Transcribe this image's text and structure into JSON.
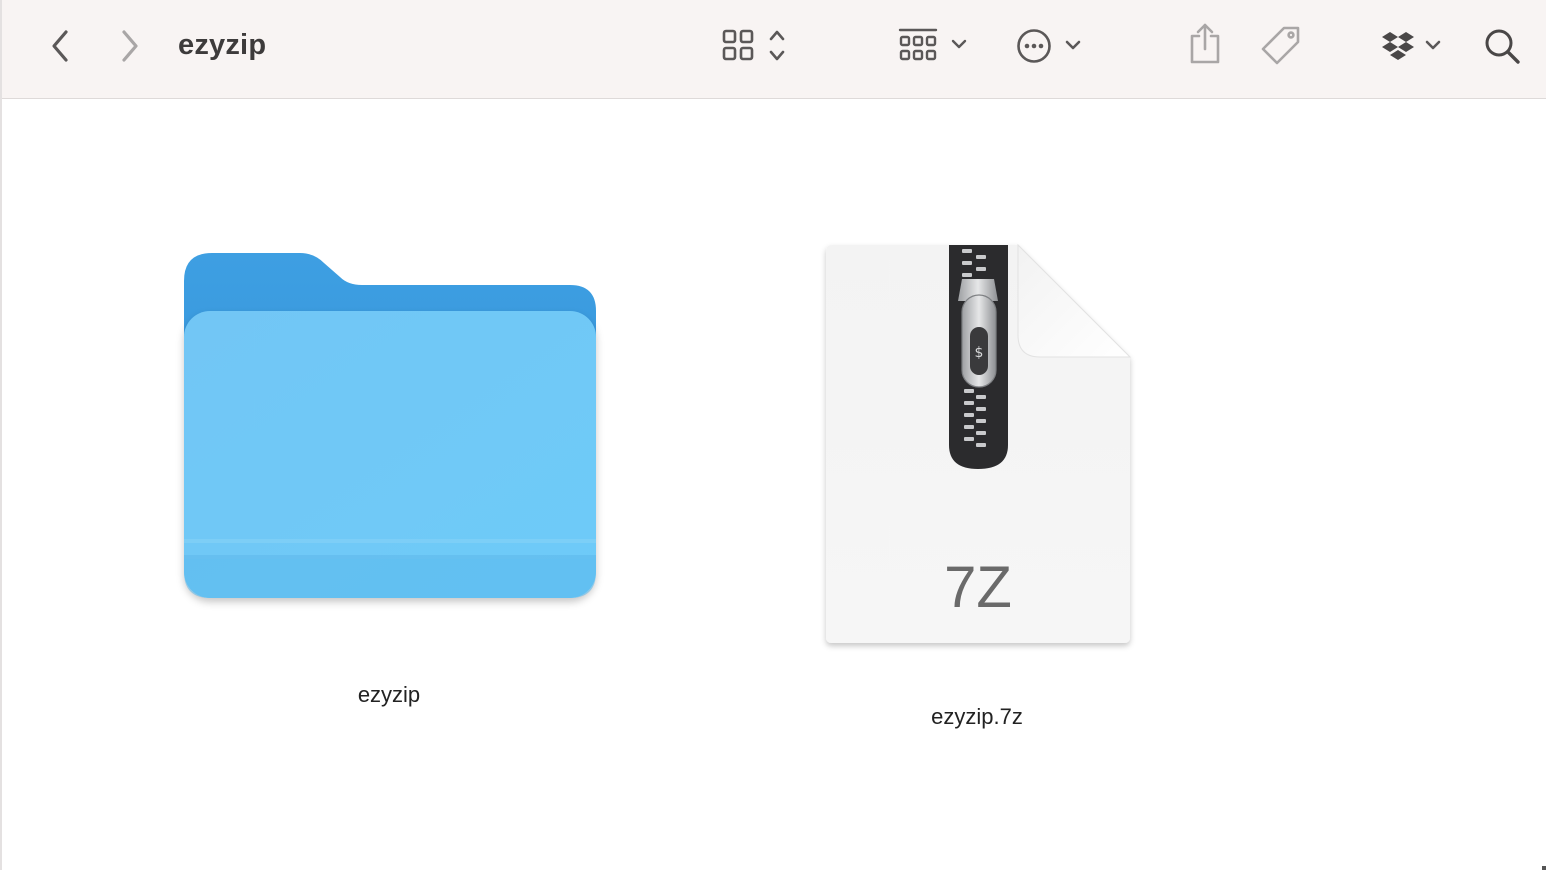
{
  "window": {
    "title": "ezyzip"
  },
  "toolbar": {
    "back": {
      "icon": "chevron-left-icon"
    },
    "forward": {
      "icon": "chevron-right-icon"
    },
    "view_mode": {
      "icon": "grid-icon"
    },
    "group": {
      "icon": "group-grid-icon"
    },
    "action": {
      "icon": "ellipsis-circle-icon"
    },
    "share": {
      "icon": "share-icon"
    },
    "tag": {
      "icon": "tag-icon"
    },
    "dropbox": {
      "icon": "dropbox-icon"
    },
    "search": {
      "icon": "search-icon"
    }
  },
  "items": [
    {
      "name": "ezyzip",
      "kind": "folder",
      "icon": "folder-icon"
    },
    {
      "name": "ezyzip.7z",
      "kind": "archive",
      "icon": "archive-7z-icon",
      "badge": "7Z"
    }
  ],
  "colors": {
    "toolbar_bg": "#f8f4f3",
    "folder_back": "#3a9be0",
    "folder_front": "#6ec8f6",
    "icon_gray": "#5b5858",
    "icon_disabled": "#a9a6a6"
  }
}
